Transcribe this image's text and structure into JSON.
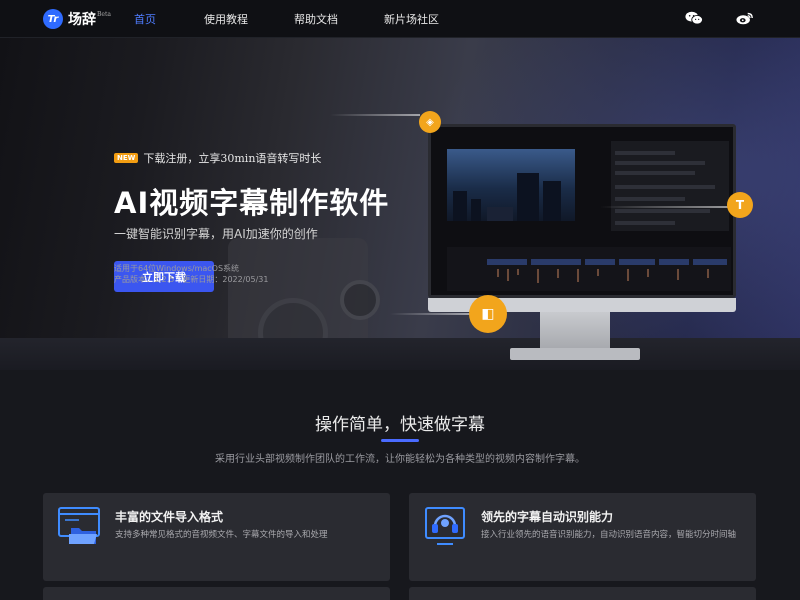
{
  "brand": {
    "name": "场辞",
    "tag": "Beta",
    "mark": "Tr",
    "accent": "#3b56f0"
  },
  "nav": {
    "links": [
      "首页",
      "使用教程",
      "帮助文档",
      "新片场社区"
    ],
    "icons": [
      "wechat-icon",
      "weibo-icon"
    ]
  },
  "hero": {
    "badge": "NEW",
    "promo": "下载注册，立享30min语音转写时长",
    "title": "AI视频字幕制作软件",
    "subtitle": "一键智能识别字幕，用AI加速你的创作",
    "download_label": "立即下载",
    "platform": "适用于64位Windows/macOS系统",
    "version": "产品版本：1.2.5　更新日期：2022/05/31"
  },
  "features": {
    "title": "操作简单，快速做字幕",
    "description": "采用行业头部视频制作团队的工作流，让你能轻松为各种类型的视频内容制作字幕。",
    "cards": [
      {
        "title": "丰富的文件导入格式",
        "desc": "支持多种常见格式的音视频文件、字幕文件的导入和处理",
        "icon": "folder-icon"
      },
      {
        "title": "领先的字幕自动识别能力",
        "desc": "接入行业领先的语音识别能力，自动识别语音内容，智能切分时间轴",
        "icon": "headset-icon"
      }
    ]
  }
}
